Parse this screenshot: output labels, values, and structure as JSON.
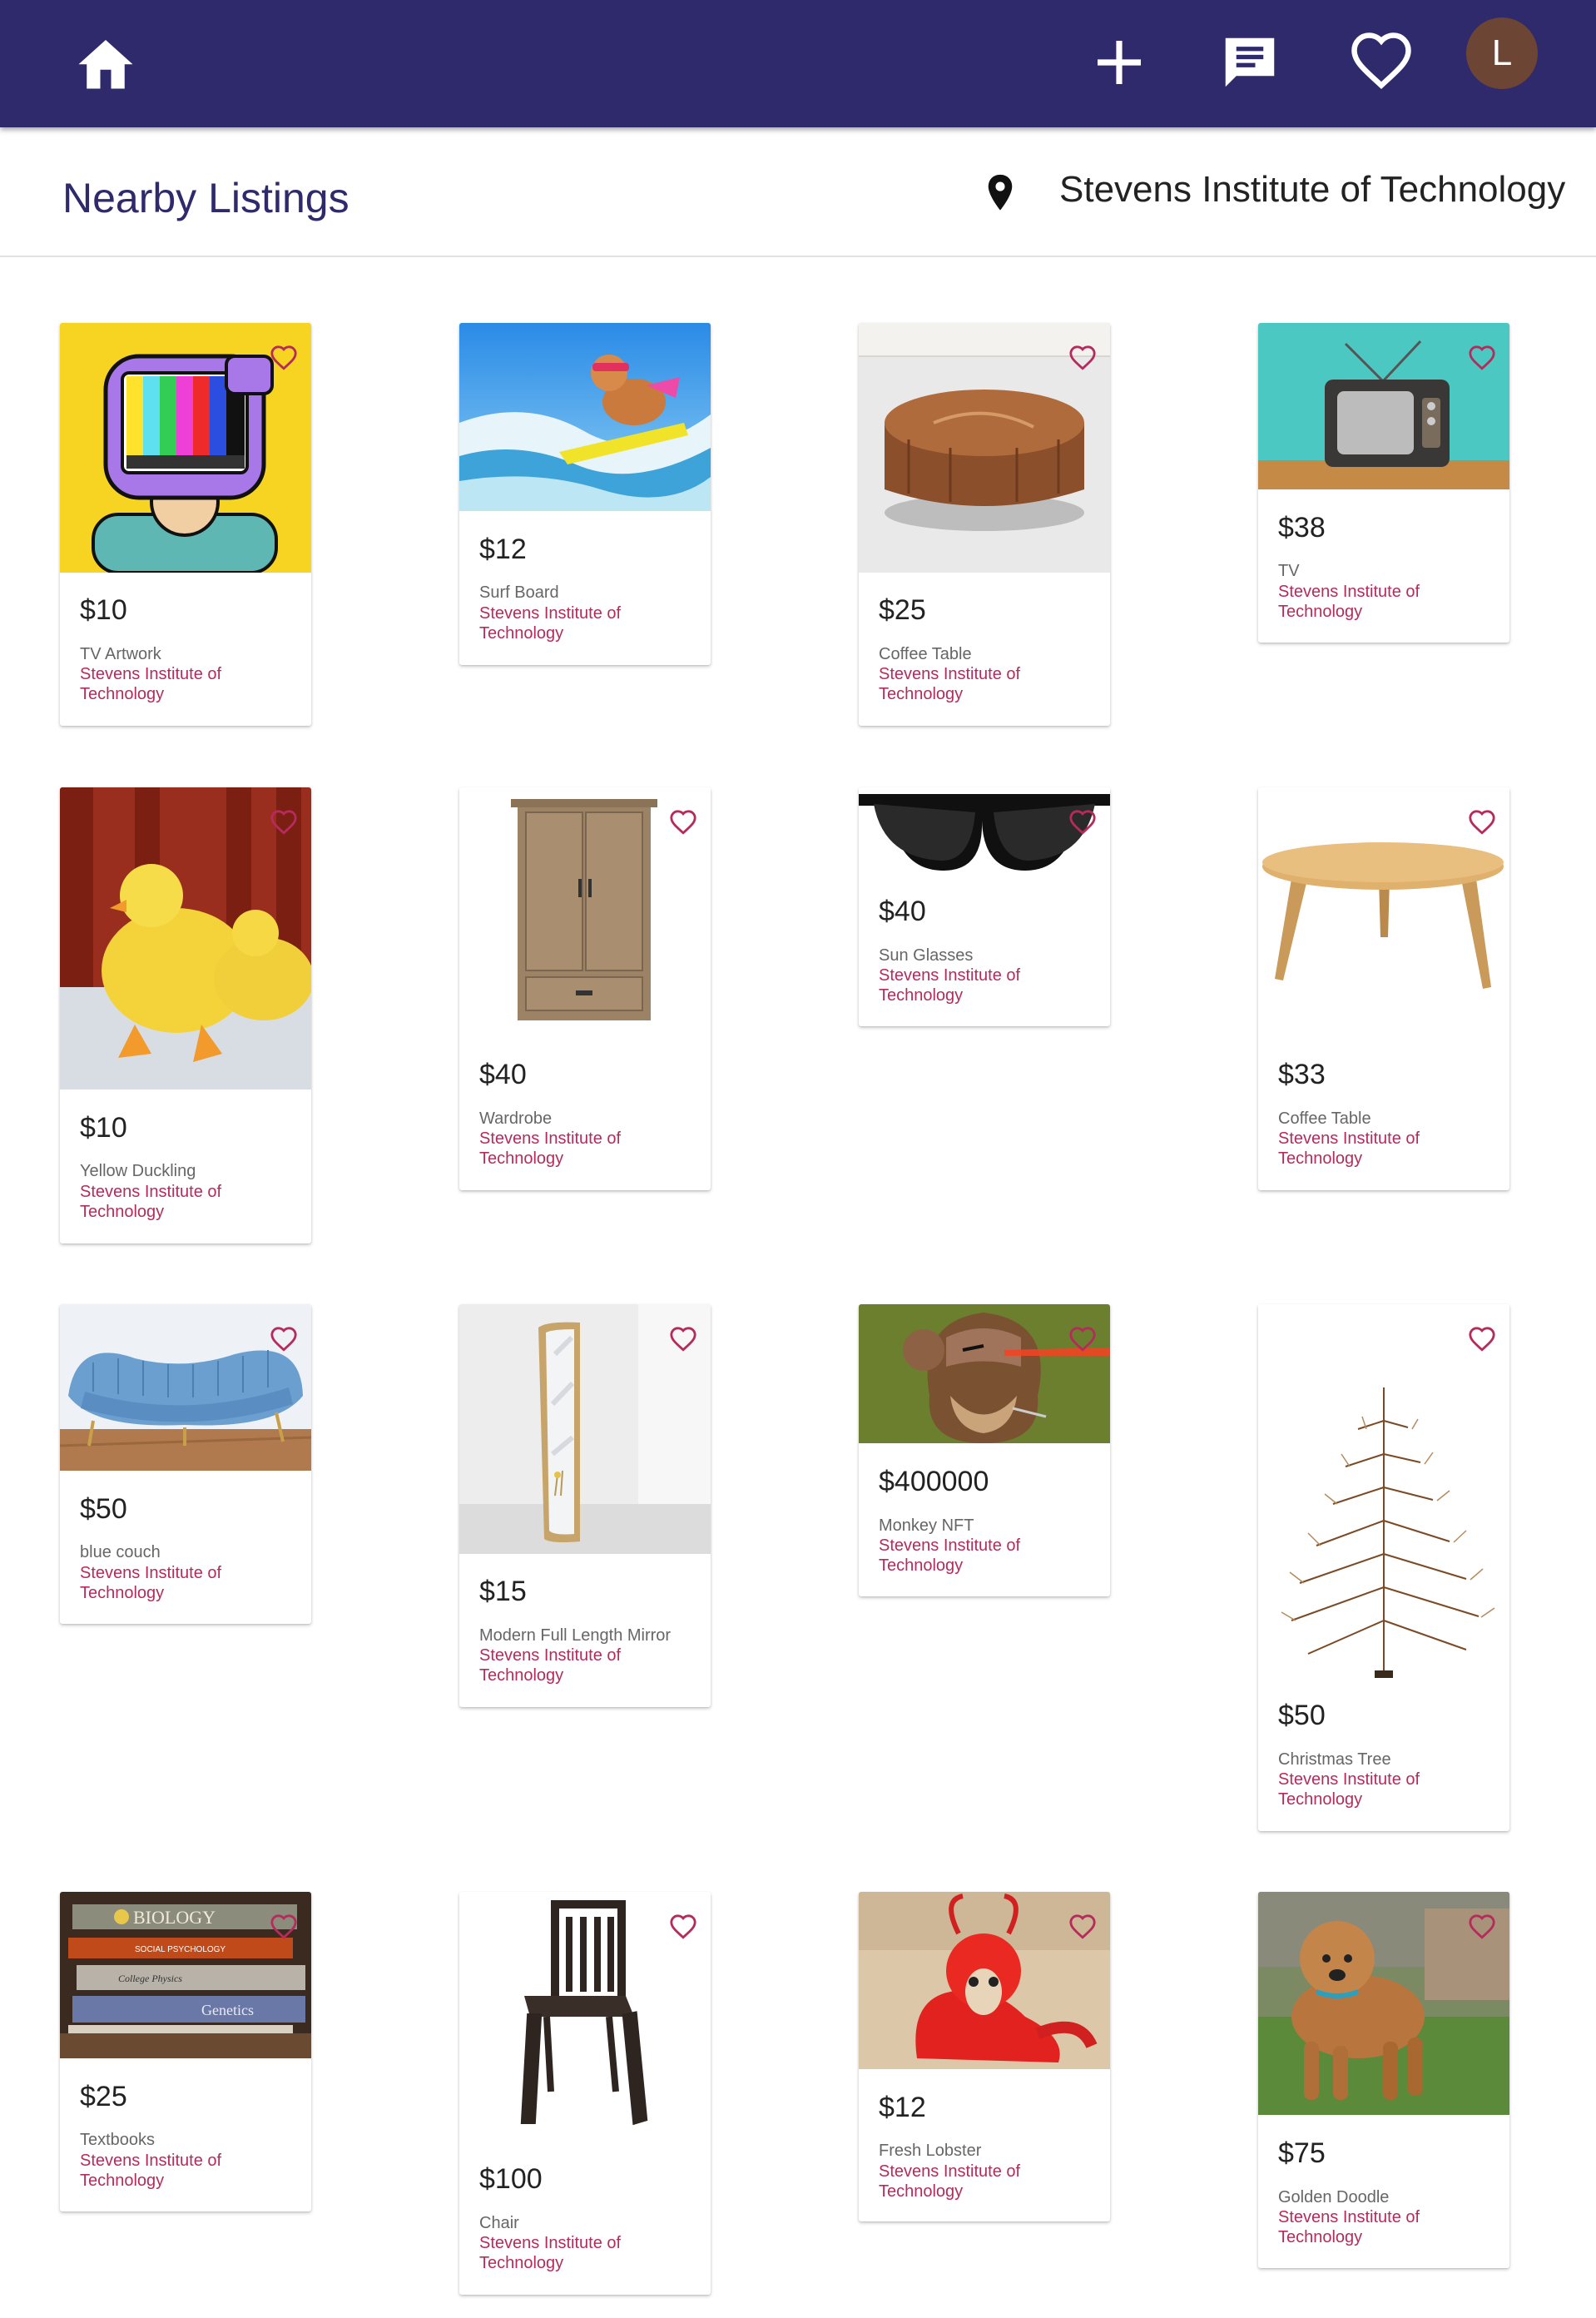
{
  "header": {
    "home_icon": "home-icon",
    "add_icon": "plus-icon",
    "chat_icon": "chat-icon",
    "favorites_icon": "heart-icon",
    "avatar_letter": "L",
    "bg_color": "#2e2a6b"
  },
  "page": {
    "title": "Nearby Listings",
    "location_icon": "location-pin-icon",
    "location": "Stevens Institute of Technology"
  },
  "colors": {
    "accent": "#b52b5c",
    "favorite": "#b52b5c"
  },
  "listings": [
    {
      "price": "$10",
      "name": "TV Artwork",
      "location": "Stevens Institute of Technology"
    },
    {
      "price": "$12",
      "name": "Surf Board",
      "location": "Stevens Institute of Technology"
    },
    {
      "price": "$25",
      "name": "Coffee Table",
      "location": "Stevens Institute of Technology"
    },
    {
      "price": "$38",
      "name": "TV",
      "location": "Stevens Institute of Technology"
    },
    {
      "price": "$10",
      "name": "Yellow Duckling",
      "location": "Stevens Institute of Technology"
    },
    {
      "price": "$40",
      "name": "Wardrobe",
      "location": "Stevens Institute of Technology"
    },
    {
      "price": "$40",
      "name": "Sun Glasses",
      "location": "Stevens Institute of Technology"
    },
    {
      "price": "$33",
      "name": "Coffee Table",
      "location": "Stevens Institute of Technology"
    },
    {
      "price": "$50",
      "name": "blue couch",
      "location": "Stevens Institute of Technology"
    },
    {
      "price": "$15",
      "name": "Modern Full Length Mirror",
      "location": "Stevens Institute of Technology"
    },
    {
      "price": "$400000",
      "name": "Monkey NFT",
      "location": "Stevens Institute of Technology"
    },
    {
      "price": "$50",
      "name": "Christmas Tree",
      "location": "Stevens Institute of Technology"
    },
    {
      "price": "$25",
      "name": "Textbooks",
      "location": "Stevens Institute of Technology"
    },
    {
      "price": "$100",
      "name": "Chair",
      "location": "Stevens Institute of Technology"
    },
    {
      "price": "$12",
      "name": "Fresh Lobster",
      "location": "Stevens Institute of Technology"
    },
    {
      "price": "$75",
      "name": "Golden Doodle",
      "location": "Stevens Institute of Technology"
    }
  ],
  "textbook_image_titles": [
    "BIOLOGY",
    "SOCIAL PSYCHOLOGY",
    "College Physics",
    "Genetics"
  ]
}
